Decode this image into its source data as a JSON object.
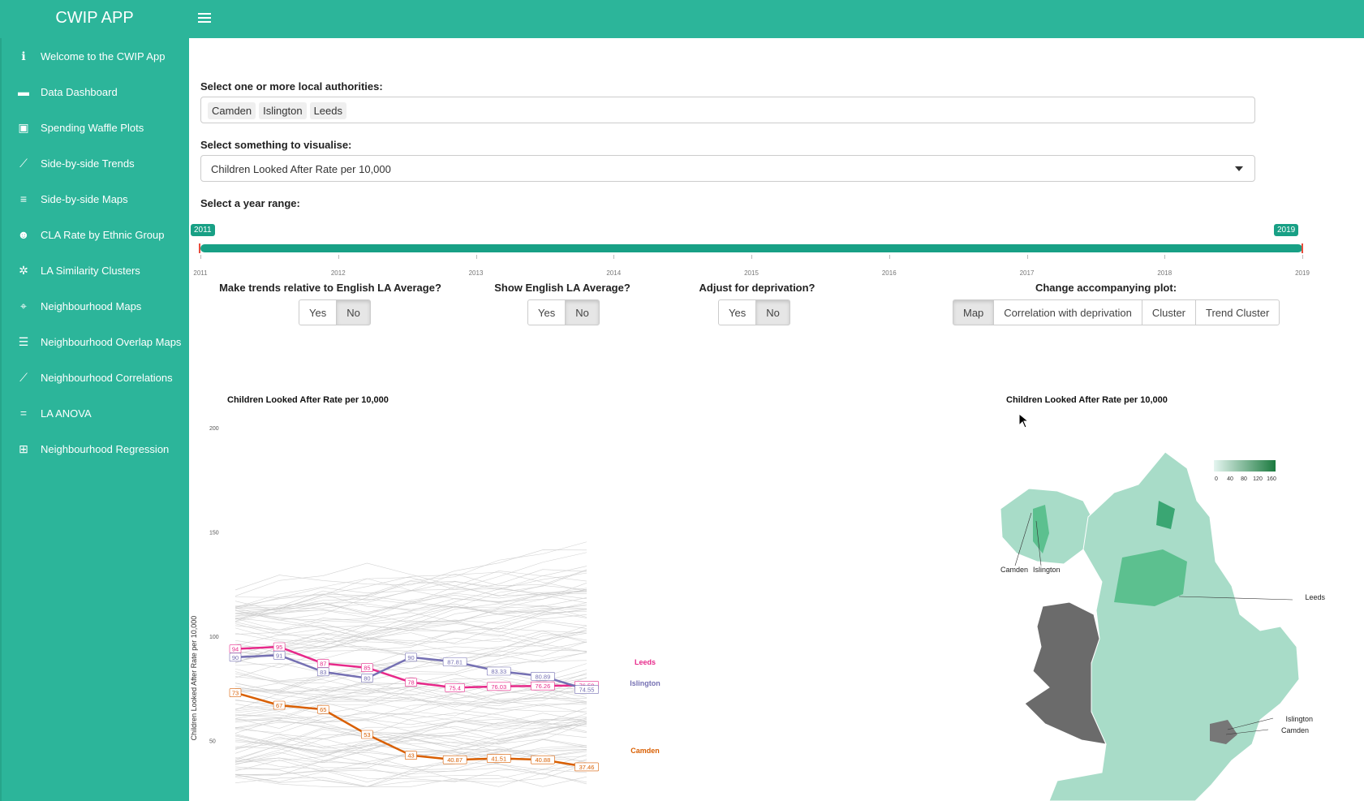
{
  "app": {
    "title": "CWIP APP"
  },
  "sidebar": {
    "items": [
      {
        "label": "Welcome to the CWIP App",
        "icon": "info-icon"
      },
      {
        "label": "Data Dashboard",
        "icon": "dashboard-icon"
      },
      {
        "label": "Spending Waffle Plots",
        "icon": "money-icon"
      },
      {
        "label": "Side-by-side Trends",
        "icon": "line-chart-icon"
      },
      {
        "label": "Side-by-side Maps",
        "icon": "signs-icon"
      },
      {
        "label": "CLA Rate by Ethnic Group",
        "icon": "users-icon"
      },
      {
        "label": "LA Similarity Clusters",
        "icon": "cluster-icon"
      },
      {
        "label": "Neighbourhood Maps",
        "icon": "map-icon"
      },
      {
        "label": "Neighbourhood Overlap Maps",
        "icon": "layers-icon"
      },
      {
        "label": "Neighbourhood Correlations",
        "icon": "line-chart-icon"
      },
      {
        "label": "LA ANOVA",
        "icon": "equals-icon"
      },
      {
        "label": "Neighbourhood Regression",
        "icon": "sitemap-icon"
      }
    ]
  },
  "filters": {
    "la_label": "Select one or more local authorities:",
    "la_selected": [
      "Camden",
      "Islington",
      "Leeds"
    ],
    "vis_label": "Select something to visualise:",
    "vis_value": "Children Looked After Rate per 10,000",
    "year_label": "Select a year range:",
    "year_from": "2011",
    "year_to": "2019",
    "year_ticks": [
      "2011",
      "2012",
      "2013",
      "2014",
      "2015",
      "2016",
      "2017",
      "2018",
      "2019"
    ]
  },
  "toggles": {
    "relative": {
      "label": "Make trends relative to English LA Average?",
      "options": [
        "Yes",
        "No"
      ],
      "selected": "No"
    },
    "show_avg": {
      "label": "Show English LA Average?",
      "options": [
        "Yes",
        "No"
      ],
      "selected": "No"
    },
    "deprivation": {
      "label": "Adjust for deprivation?",
      "options": [
        "Yes",
        "No"
      ],
      "selected": "No"
    },
    "plot": {
      "label": "Change accompanying plot:",
      "options": [
        "Map",
        "Correlation with deprivation",
        "Cluster",
        "Trend Cluster"
      ],
      "selected": "Map"
    }
  },
  "chart_data": [
    {
      "type": "line",
      "title": "Children Looked After Rate per 10,000",
      "ylabel": "Children Looked After Rate per 10,000",
      "yticks": [
        50,
        100,
        150,
        200
      ],
      "x": [
        2011,
        2012,
        2013,
        2014,
        2015,
        2016,
        2017,
        2018,
        2019
      ],
      "series": [
        {
          "name": "Leeds",
          "color": "#e7298a",
          "values": [
            94,
            95,
            87,
            85,
            78,
            75.4,
            76.03,
            76.26,
            76.59
          ],
          "labels": [
            "94",
            "95",
            "87",
            "85",
            "78",
            "75.4",
            "76.03",
            "76.26",
            "76.59"
          ]
        },
        {
          "name": "Islington",
          "color": "#7570b3",
          "values": [
            90,
            91,
            83,
            80,
            90,
            87.81,
            83.33,
            80.89,
            74.55
          ],
          "labels": [
            "90",
            "91",
            "83",
            "80",
            "90",
            "87.81",
            "83.33",
            "80.89",
            "74.55"
          ]
        },
        {
          "name": "Camden",
          "color": "#d95f02",
          "values": [
            73,
            67,
            65,
            53,
            43,
            40.87,
            41.51,
            40.88,
            37.46
          ],
          "labels": [
            "73",
            "67",
            "65",
            "53",
            "43",
            "40.87",
            "41.51",
            "40.88",
            "37.46"
          ]
        }
      ]
    },
    {
      "type": "map",
      "title": "Children Looked After Rate per 10,000",
      "legend_ticks": [
        "0",
        "40",
        "80",
        "120",
        "160"
      ],
      "labels": [
        "Camden",
        "Islington",
        "Leeds",
        "Islington",
        "Camden"
      ]
    }
  ]
}
